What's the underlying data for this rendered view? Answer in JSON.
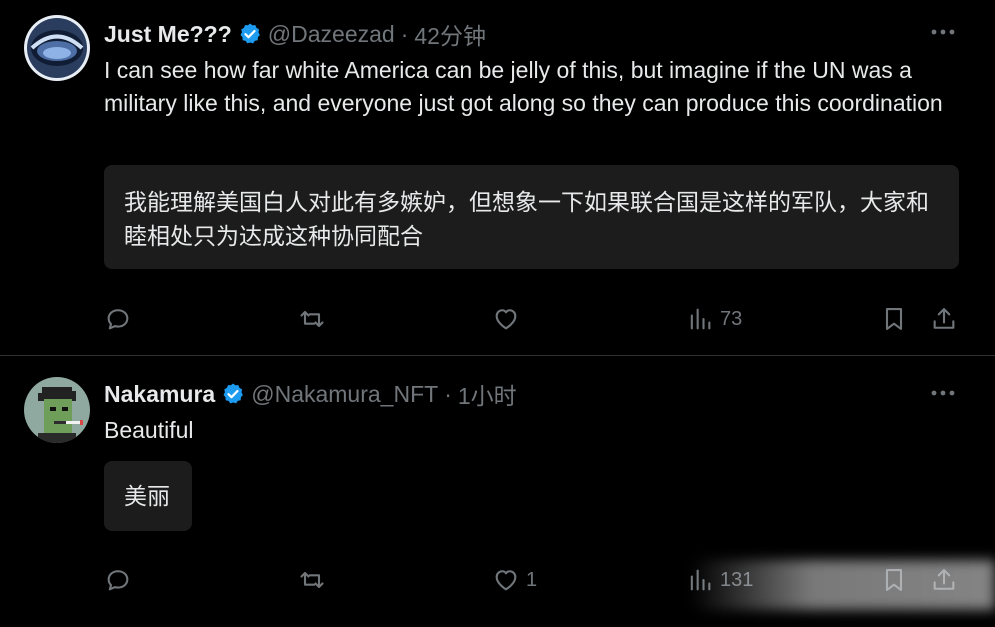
{
  "tweets": [
    {
      "name": "Just Me???",
      "handle": "@Dazeezad",
      "separator": "·",
      "time": "42分钟",
      "text": "I can see how far white America can be jelly of this, but imagine if the UN was a military like this, and everyone just got along so they can produce this coordination",
      "translation": "我能理解美国白人对此有多嫉妒，但想象一下如果联合国是这样的军队，大家和睦相处只为达成这种协同配合",
      "views": "73",
      "likes": ""
    },
    {
      "name": "Nakamura",
      "handle": "@Nakamura_NFT",
      "separator": "·",
      "time": "1小时",
      "text": "Beautiful",
      "translation": "美丽",
      "views": "131",
      "likes": "1"
    }
  ],
  "icons": {
    "verified": "verified-badge-icon",
    "more": "more-icon",
    "reply": "reply-icon",
    "retweet": "retweet-icon",
    "like": "like-icon",
    "views": "views-icon",
    "bookmark": "bookmark-icon",
    "share": "share-icon"
  },
  "colors": {
    "background": "#000000",
    "text": "#e7e9ea",
    "muted": "#71767b",
    "verified": "#1d9bf0",
    "translation_bg": "#1c1c1c",
    "divider": "#2f3336"
  }
}
